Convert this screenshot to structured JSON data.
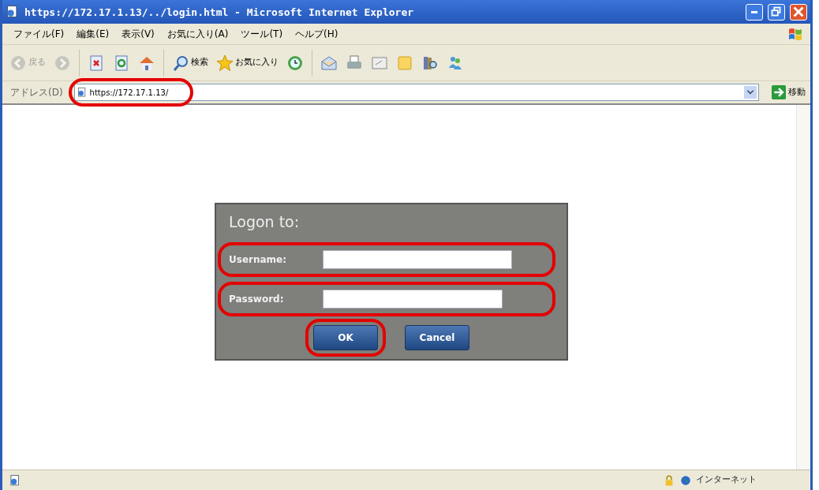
{
  "window": {
    "title": "https://172.17.1.13/../login.html - Microsoft Internet Explorer"
  },
  "menu": [
    "ファイル(F)",
    "編集(E)",
    "表示(V)",
    "お気に入り(A)",
    "ツール(T)",
    "ヘルプ(H)"
  ],
  "toolbar": [
    {
      "kind": "back",
      "label": "戻る",
      "disabled": true
    },
    {
      "kind": "forward",
      "disabled": true
    },
    {
      "kind": "stop",
      "disabled": false
    },
    {
      "kind": "refresh",
      "disabled": false
    },
    {
      "kind": "home",
      "disabled": false
    },
    {
      "kind": "search",
      "label": "検索",
      "disabled": false
    },
    {
      "kind": "favorites",
      "label": "お気に入り",
      "disabled": false
    },
    {
      "kind": "history",
      "disabled": false
    },
    {
      "kind": "mail",
      "disabled": false
    },
    {
      "kind": "print",
      "disabled": false
    },
    {
      "kind": "edit",
      "disabled": false
    },
    {
      "kind": "notes",
      "disabled": false
    },
    {
      "kind": "research",
      "disabled": false
    },
    {
      "kind": "messenger",
      "disabled": false
    }
  ],
  "address": {
    "label": "アドレス(D)",
    "value": "https://172.17.1.13/",
    "highlighted": true,
    "go": "移動"
  },
  "dialog": {
    "title": "Logon to:",
    "fields": [
      {
        "label": "Username:",
        "highlighted": true
      },
      {
        "label": "Password:",
        "highlighted": true
      }
    ],
    "buttons": [
      {
        "label": "OK",
        "highlighted": true
      },
      {
        "label": "Cancel",
        "highlighted": false
      }
    ]
  },
  "status_bar": {
    "zone": "インターネット"
  }
}
